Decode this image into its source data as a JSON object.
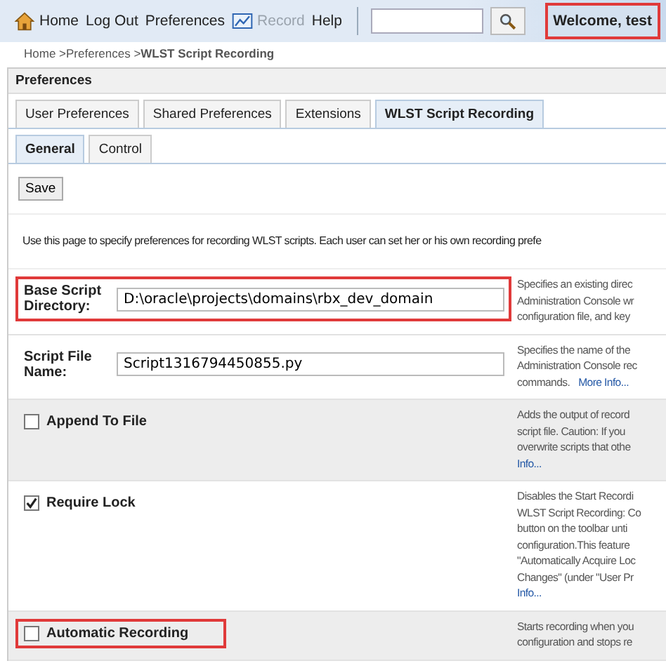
{
  "toolbar": {
    "links": [
      {
        "label": "Home",
        "kind": "home",
        "disabled": false
      },
      {
        "label": "Log Out",
        "disabled": false
      },
      {
        "label": "Preferences",
        "disabled": false
      },
      {
        "label": "Record",
        "kind": "record",
        "disabled": true
      },
      {
        "label": "Help",
        "disabled": false
      }
    ],
    "welcome": {
      "text": "Welcome, test",
      "highlighted": true
    }
  },
  "breadcrumb": "Home >Preferences >**WLST Script Recording**",
  "panel_title": "Preferences",
  "tabs": [
    {
      "label": "User Preferences",
      "selected": false
    },
    {
      "label": "Shared Preferences",
      "selected": false
    },
    {
      "label": "Extensions",
      "selected": false
    },
    {
      "label": "WLST Script Recording",
      "selected": true
    }
  ],
  "subtabs": [
    {
      "label": "General",
      "selected": true
    },
    {
      "label": "Control",
      "selected": false
    }
  ],
  "save_button": "Save",
  "intro": "Use this page to specify preferences for recording WLST scripts. Each user can set her or his own recording prefe",
  "rows": [
    {
      "kind": "field",
      "label": "Base Script Directory:",
      "value": "D:\\oracle\\projects\\domains\\rbx_dev_domain",
      "highlighted": true,
      "shaded": false,
      "description": [
        {
          "text": "Specifies an existing direc"
        },
        {
          "text": "Administration Console wr"
        },
        {
          "text": "configuration file, and key"
        }
      ]
    },
    {
      "kind": "field",
      "label": "Script File Name:",
      "value": "Script1316794450855.py",
      "highlighted": false,
      "shaded": false,
      "description": [
        {
          "text": "Specifies the name of the"
        },
        {
          "text": "Administration Console rec"
        },
        {
          "text": "commands.",
          "link": "More Info..."
        }
      ]
    },
    {
      "kind": "checkbox",
      "label": "Append To File",
      "checked": false,
      "highlighted": false,
      "shaded": true,
      "description": [
        {
          "text": "Adds the output of record"
        },
        {
          "text": "script file. Caution: If you"
        },
        {
          "text": "overwrite scripts that othe"
        },
        {
          "link": "Info..."
        }
      ]
    },
    {
      "kind": "checkbox",
      "label": "Require Lock",
      "checked": true,
      "highlighted": false,
      "shaded": false,
      "description": [
        {
          "text": "Disables the Start Recordi"
        },
        {
          "text": "WLST Script Recording: Co"
        },
        {
          "text": "button on the toolbar unti"
        },
        {
          "text": "configuration.This feature"
        },
        {
          "text": "\"Automatically Acquire Loc"
        },
        {
          "text": "Changes\" (under \"User Pr"
        },
        {
          "link": "Info..."
        }
      ]
    },
    {
      "kind": "checkbox",
      "label": "Automatic Recording",
      "checked": false,
      "highlighted": true,
      "shaded": true,
      "description": [
        {
          "text": "Starts recording when you"
        },
        {
          "text": "configuration and stops re"
        }
      ]
    }
  ]
}
